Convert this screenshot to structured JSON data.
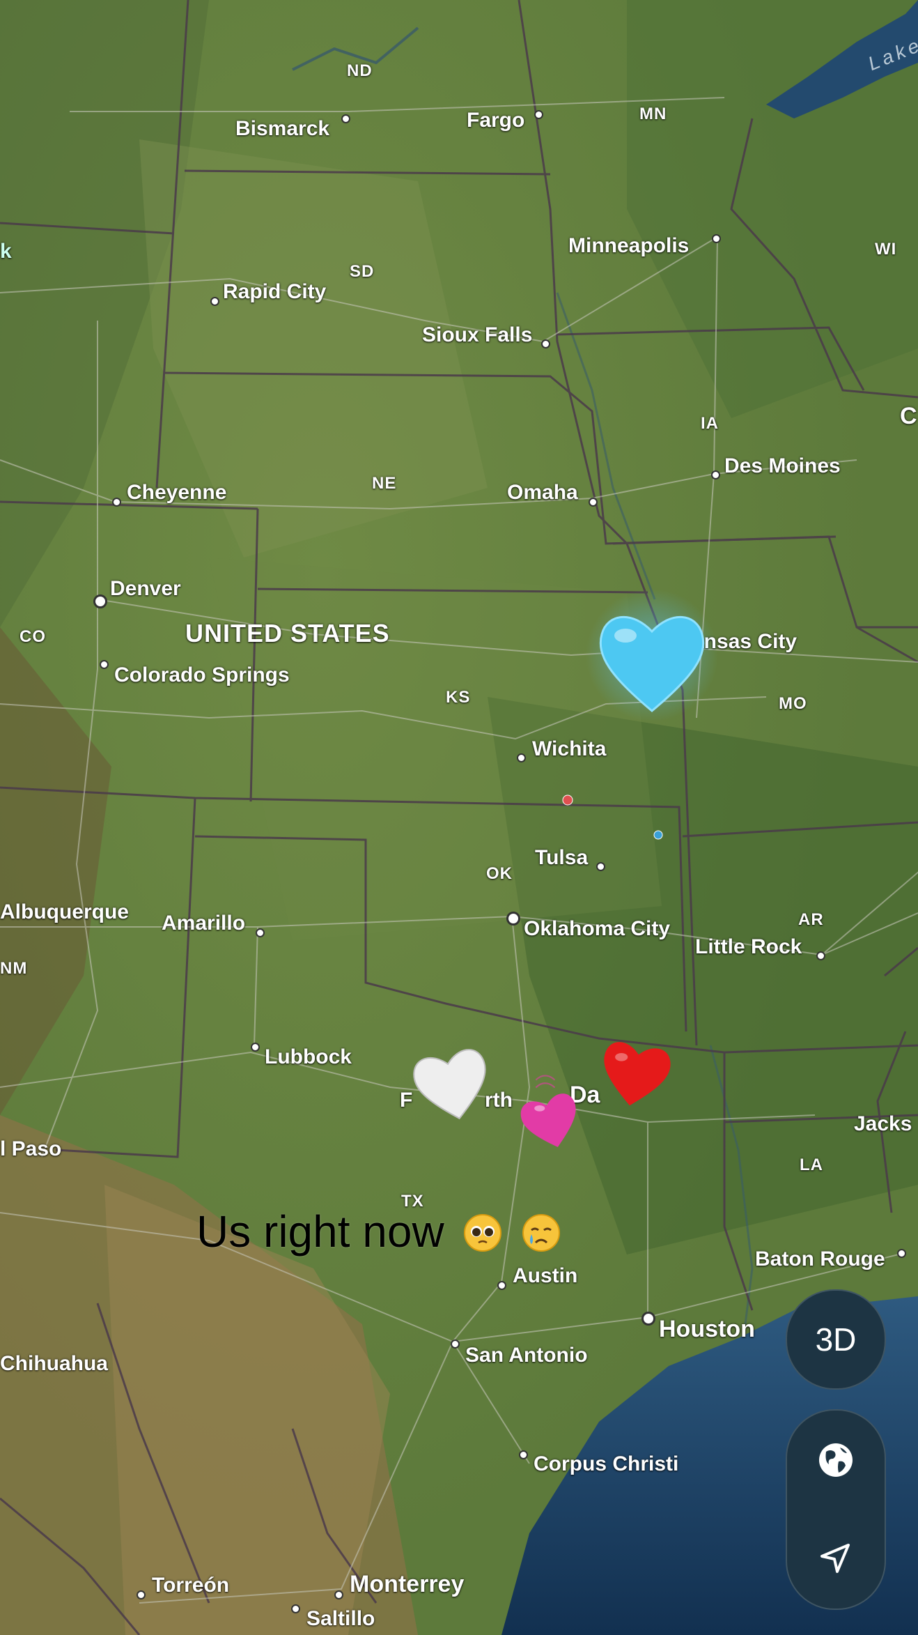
{
  "map": {
    "country_label": "UNITED STATES",
    "lake_label": "Lake",
    "states": [
      "ND",
      "MN",
      "SD",
      "WI",
      "IA",
      "NE",
      "CO",
      "KS",
      "MO",
      "OK",
      "AR",
      "NM",
      "TX",
      "LA"
    ],
    "cities": [
      "Bismarck",
      "Fargo",
      "Minneapolis",
      "Rapid City",
      "Sioux Falls",
      "Des Moines",
      "Cheyenne",
      "Omaha",
      "Denver",
      "ansas City",
      "Colorado Springs",
      "Wichita",
      "Tulsa",
      "Albuquerque",
      "Amarillo",
      "Oklahoma City",
      "Little Rock",
      "Lubbock",
      "F",
      "rth",
      "Da",
      "Jacks",
      "l Paso",
      "Austin",
      "Baton Rouge",
      "Houston",
      "San Antonio",
      "Chihuahua",
      "Corpus Christi",
      "Torreón",
      "Monterrey",
      "Saltillo"
    ],
    "partial_edge_labels": [
      "k",
      "C"
    ]
  },
  "markers": [
    {
      "name": "light-blue-heart",
      "color": "#4dc8f2"
    },
    {
      "name": "white-heart",
      "color": "#eeeeee"
    },
    {
      "name": "pink-heart",
      "color": "#e23ba6"
    },
    {
      "name": "red-heart",
      "color": "#e51a1a"
    }
  ],
  "caption": {
    "text": "Us right now",
    "emoji_1": "pleading-face",
    "emoji_2": "crying-face"
  },
  "controls": {
    "mode_3d_label": "3D",
    "globe_icon": "globe-icon",
    "location_icon": "location-arrow-icon"
  }
}
